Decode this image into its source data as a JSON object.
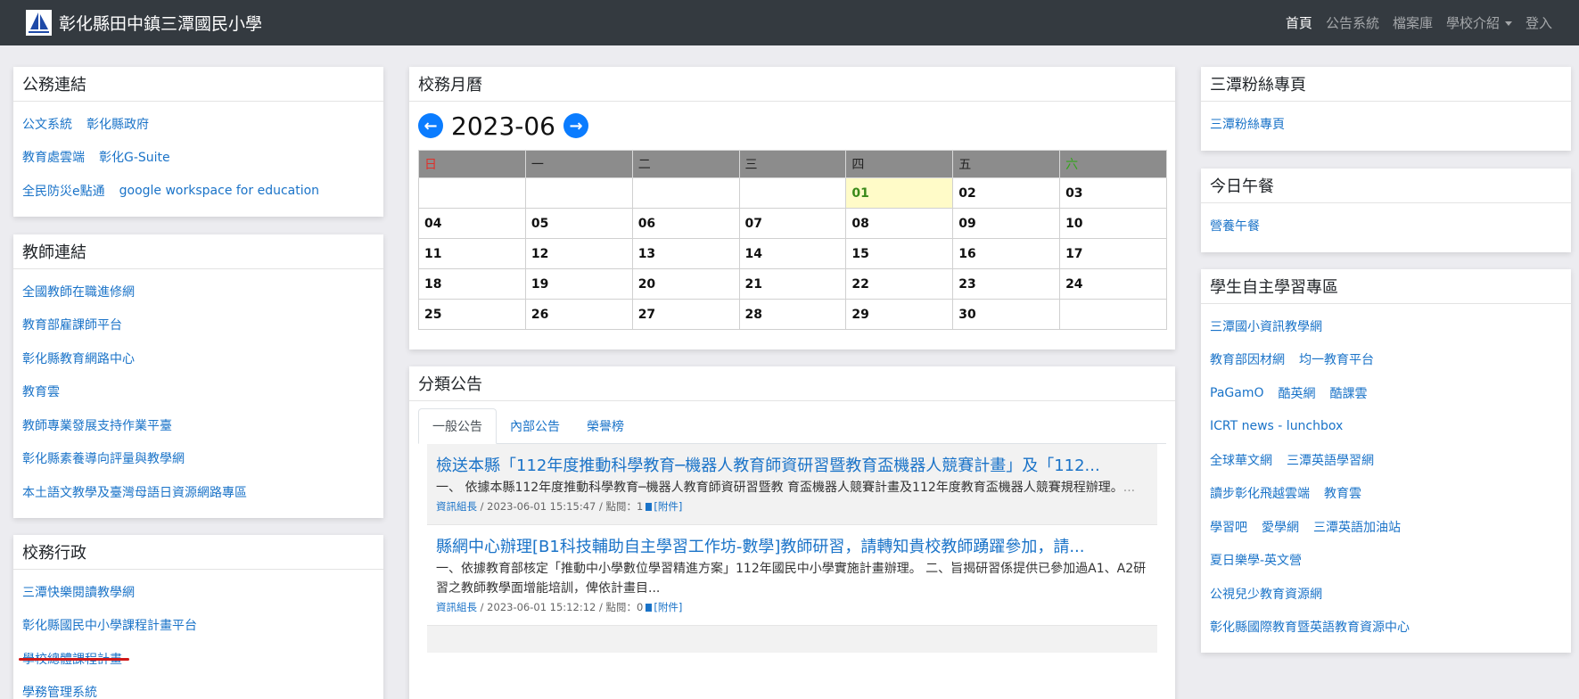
{
  "brand": {
    "title": "彰化縣田中鎮三潭國民小學"
  },
  "nav": [
    {
      "label": "首頁",
      "active": true
    },
    {
      "label": "公告系統"
    },
    {
      "label": "檔案庫"
    },
    {
      "label": "學校介紹",
      "dropdown": true
    },
    {
      "label": "登入"
    }
  ],
  "official_links": {
    "title": "公務連結",
    "rows": [
      [
        "公文系統",
        "彰化縣政府"
      ],
      [
        "教育處雲端",
        "彰化G-Suite"
      ],
      [
        "全民防災e點通",
        "google workspace for education"
      ]
    ]
  },
  "teacher_links": {
    "title": "教師連結",
    "rows": [
      [
        "全國教師在職進修網"
      ],
      [
        "教育部雇課師平台"
      ],
      [
        "彰化縣教育網路中心"
      ],
      [
        "教育雲"
      ],
      [
        "教師專業發展支持作業平臺"
      ],
      [
        "彰化縣素養導向評量與教學網"
      ],
      [
        "本土語文教學及臺灣母語日資源網路專區"
      ]
    ]
  },
  "admin_links": {
    "title": "校務行政",
    "rows": [
      [
        "三潭快樂閱讀教學網"
      ],
      [
        "彰化縣國民中小學課程計畫平台"
      ],
      [
        "學校總體課程計畫"
      ],
      [
        "學務管理系統"
      ]
    ]
  },
  "calendar": {
    "title": "校務月曆",
    "month": "2023-06",
    "prev_icon": "arrow-left-icon",
    "next_icon": "arrow-right-icon",
    "weekdays": [
      "日",
      "一",
      "二",
      "三",
      "四",
      "五",
      "六"
    ],
    "weeks": [
      [
        "",
        "",
        "",
        "",
        "01",
        "02",
        "03"
      ],
      [
        "04",
        "05",
        "06",
        "07",
        "08",
        "09",
        "10"
      ],
      [
        "11",
        "12",
        "13",
        "14",
        "15",
        "16",
        "17"
      ],
      [
        "18",
        "19",
        "20",
        "21",
        "22",
        "23",
        "24"
      ],
      [
        "25",
        "26",
        "27",
        "28",
        "29",
        "30",
        ""
      ]
    ],
    "today": "01",
    "colors": {
      "sunday": "#e0302a",
      "saturday": "#34a41c",
      "today_bg": "#fffbc8",
      "header_bg": "#8c8c8c"
    }
  },
  "announcements": {
    "title": "分類公告",
    "tabs": [
      {
        "label": "一般公告",
        "active": true
      },
      {
        "label": "內部公告"
      },
      {
        "label": "榮譽榜"
      }
    ],
    "posts": [
      {
        "title": "檢送本縣「112年度推動科學教育─機器人教育師資研習暨教育盃機器人競賽計畫」及「112...",
        "body": "一、 依據本縣112年度推動科學教育─機器人教育師資研習暨教 育盃機器人競賽計畫及112年度教育盃機器人競賽規程辦理。",
        "more": "...",
        "author": "資訊組長",
        "meta": " / 2023-06-01 15:15:47 / 點閱：1",
        "attachment": "[附件]"
      },
      {
        "title": "縣網中心辦理[B1科技輔助自主學習工作坊-數學]教師研習，請轉知貴校教師踴躍參加，請...",
        "body": "一、依據教育部核定「推動中小學數位學習精進方案」112年國民中小學實施計畫辦理。 二、旨揭研習係提供已參加過A1、A2研習之教師教學面增能培訓，俾依計畫目...",
        "more": "",
        "author": "資訊組長",
        "meta": " / 2023-06-01 15:12:12 / 點閱：0",
        "attachment": "[附件]"
      }
    ]
  },
  "fans": {
    "title": "三潭粉絲專頁",
    "rows": [
      [
        "三潭粉絲專頁"
      ]
    ]
  },
  "lunch": {
    "title": "今日午餐",
    "rows": [
      [
        "營養午餐"
      ]
    ]
  },
  "self_learning": {
    "title": "學生自主學習專區",
    "rows": [
      [
        "三潭國小資訊教學網"
      ],
      [
        "教育部因材網",
        "均一教育平台"
      ],
      [
        "PaGamO",
        "酷英網",
        "酷課雲"
      ],
      [
        "ICRT news - lunchbox"
      ],
      [
        "全球華文網",
        "三潭英語學習網"
      ],
      [
        "讀步彰化飛越雲端",
        "教育雲"
      ],
      [
        "學習吧",
        "愛學網",
        "三潭英語加油站"
      ],
      [
        "夏日樂學-英文營"
      ],
      [
        "公視兒少教育資源網"
      ],
      [
        "彰化縣國際教育暨英語教育資源中心"
      ]
    ]
  }
}
